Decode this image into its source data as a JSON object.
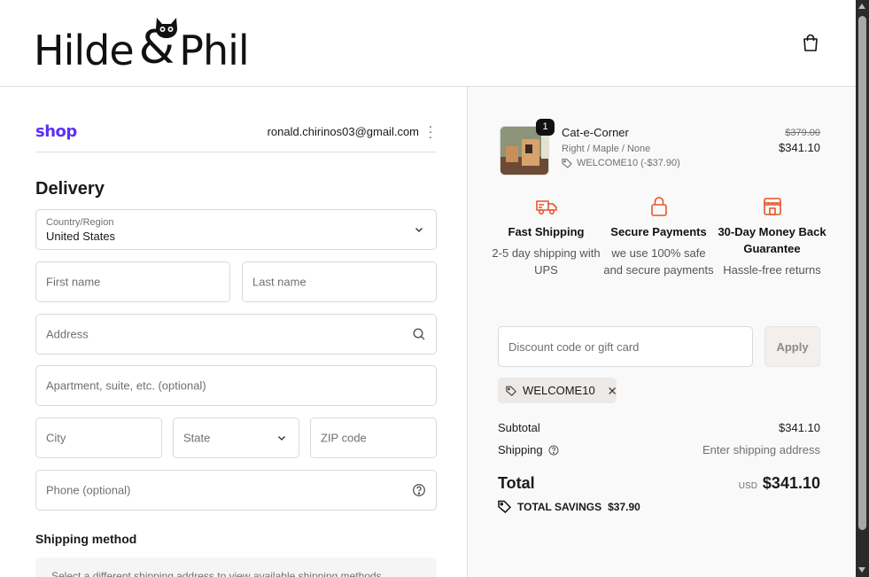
{
  "header": {
    "logo_left": "Hilde",
    "logo_amp": "&",
    "logo_right": "Phil",
    "cart_icon": "shopping-bag-icon"
  },
  "account": {
    "shop_label": "shop",
    "email": "ronald.chirinos03@gmail.com",
    "menu_icon": "more-vertical-icon"
  },
  "delivery": {
    "title": "Delivery",
    "country_label": "Country/Region",
    "country_value": "United States",
    "first_name_placeholder": "First name",
    "last_name_placeholder": "Last name",
    "address_placeholder": "Address",
    "apartment_placeholder": "Apartment, suite, etc. (optional)",
    "city_placeholder": "City",
    "state_placeholder": "State",
    "zip_placeholder": "ZIP code",
    "phone_placeholder": "Phone (optional)"
  },
  "shipping_method": {
    "title": "Shipping method",
    "notice": "Select a different shipping address to view available shipping methods"
  },
  "order": {
    "item": {
      "quantity": "1",
      "name": "Cat-e-Corner",
      "variant": "Right / Maple / None",
      "discount": "WELCOME10 (-$37.90)",
      "price_original": "$379.00",
      "price_final": "$341.10"
    },
    "features": [
      {
        "icon": "truck-icon",
        "title": "Fast Shipping",
        "desc": "2-5 day shipping with UPS"
      },
      {
        "icon": "lock-icon",
        "title": "Secure Payments",
        "desc": "we use 100% safe and secure payments"
      },
      {
        "icon": "store-icon",
        "title": "30-Day Money Back Guarantee",
        "desc": "Hassle-free returns"
      }
    ],
    "discount_placeholder": "Discount code or gift card",
    "apply_label": "Apply",
    "applied_code": "WELCOME10",
    "subtotal_label": "Subtotal",
    "subtotal_value": "$341.10",
    "shipping_label": "Shipping",
    "shipping_value": "Enter shipping address",
    "total_label": "Total",
    "currency": "USD",
    "total_value": "$341.10",
    "savings_label": "TOTAL SAVINGS",
    "savings_value": "$37.90"
  },
  "colors": {
    "shop_brand": "#5a31f4",
    "feature_accent": "#e8532b"
  }
}
